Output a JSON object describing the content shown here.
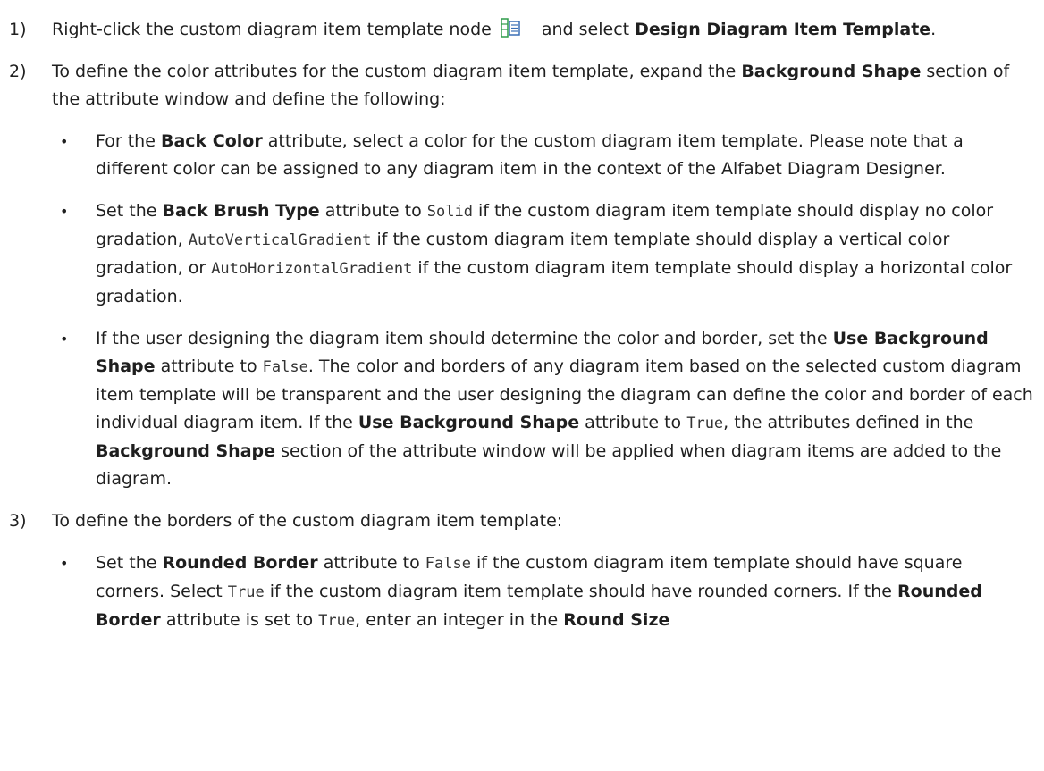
{
  "step1": {
    "num": "1)",
    "t1": "Right-click the custom diagram item template node",
    "t2": "and select",
    "b1": "Design Diagram Item Template",
    "t3": ".",
    "icon": "diagram-template-node-icon"
  },
  "step2": {
    "num": "2)",
    "t1": "To define the color attributes for the custom diagram item template, expand the",
    "b1": "Background Shape",
    "t2": "section of the attribute window and define the following:"
  },
  "bullet1": {
    "t1": "For the",
    "b1": "Back Color",
    "t2": "attribute, select a color for the custom diagram item template. Please note that a different color can be assigned to any diagram item in the context of the Alfabet Diagram Designer."
  },
  "bullet2": {
    "t1": "Set the",
    "b1": "Back Brush Type",
    "t2": "attribute to",
    "c1": "Solid",
    "t3": "if the custom diagram item template should display no color gradation,",
    "c2": "AutoVerticalGradient",
    "t4": "if the custom diagram item template should display a vertical color gradation, or",
    "c3": "AutoHorizontalGradient",
    "t5": "if the custom diagram item template should display a horizontal color gradation."
  },
  "bullet3": {
    "t1": "If the user designing the diagram item should determine the color and border, set the",
    "b1": "Use Background Shape",
    "t2": "attribute to",
    "c1": "False",
    "t3": ". The color and borders of any diagram item based on the selected custom diagram item template will be transparent and the user designing the diagram can define the color and border of each individual diagram item. If the",
    "b2": "Use Background Shape",
    "t4": "attribute to",
    "c2": "True",
    "t5": ", the attributes defined in the",
    "b3": "Background Shape",
    "t6": "section of the attribute window will be applied when diagram items are added to the diagram."
  },
  "step3": {
    "num": "3)",
    "t1": "To define the borders of the custom diagram item template:"
  },
  "bullet4": {
    "t1": "Set the",
    "b1": "Rounded Border",
    "t2": "attribute to",
    "c1": "False",
    "t3": "if the custom diagram item template should have square corners. Select",
    "c2": "True",
    "t4": "if the custom diagram item template should have rounded corners. If the",
    "b2": "Rounded Border",
    "t5": "attribute is set to",
    "c3": "True",
    "t6": ", enter an integer in the",
    "b3": "Round Size"
  },
  "colors": {
    "text": "#1f1f1f",
    "icon_green": "#2e9b4a",
    "icon_blue": "#3a6fb5"
  }
}
